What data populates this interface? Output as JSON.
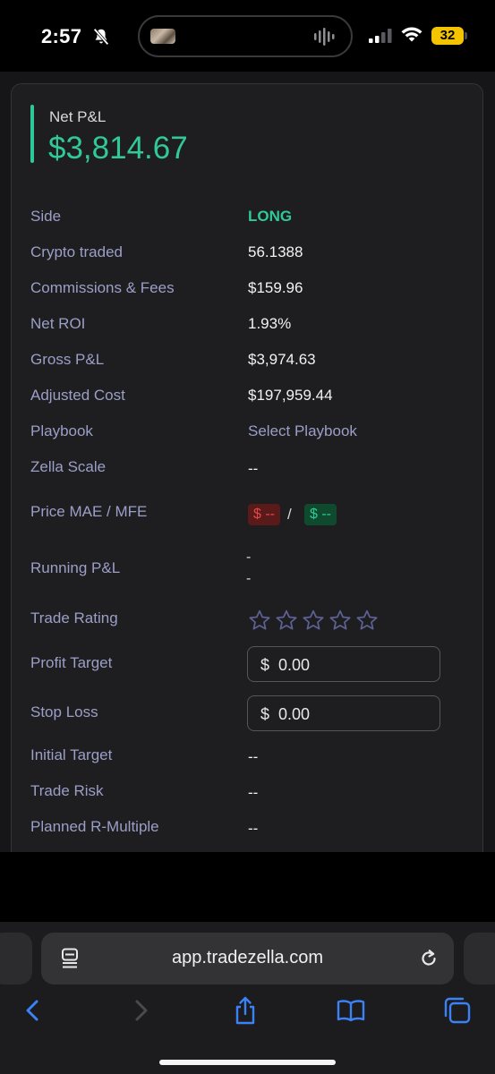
{
  "status_bar": {
    "time": "2:57",
    "battery": "32",
    "icons": [
      "bell-slash-icon",
      "audio-wave-icon",
      "signal-icon",
      "wifi-icon",
      "battery-icon"
    ]
  },
  "trade": {
    "net_pnl_label": "Net P&L",
    "net_pnl_value": "$3,814.67",
    "rows": [
      {
        "label": "Side",
        "value": "LONG"
      },
      {
        "label": "Crypto traded",
        "value": "56.1388"
      },
      {
        "label": "Commissions & Fees",
        "value": "$159.96"
      },
      {
        "label": "Net ROI",
        "value": "1.93%"
      },
      {
        "label": "Gross P&L",
        "value": "$3,974.63"
      },
      {
        "label": "Adjusted Cost",
        "value": "$197,959.44"
      },
      {
        "label": "Playbook",
        "value": "Select Playbook"
      },
      {
        "label": "Zella Scale",
        "value": "--"
      },
      {
        "label": "Price MAE / MFE",
        "mae": "$ --",
        "separator": "/",
        "mfe": "$ --"
      },
      {
        "label": "Running P&L",
        "value_line1": "-",
        "value_line2": "-"
      },
      {
        "label": "Trade Rating",
        "rating": 0,
        "max_rating": 5
      },
      {
        "label": "Profit Target",
        "currency": "$",
        "value": "0.00"
      },
      {
        "label": "Stop Loss",
        "currency": "$",
        "value": "0.00"
      },
      {
        "label": "Initial Target",
        "value": "--"
      },
      {
        "label": "Trade Risk",
        "value": "--"
      },
      {
        "label": "Planned R-Multiple",
        "value": "--"
      }
    ]
  },
  "browser": {
    "url": "app.tradezella.com"
  },
  "colors": {
    "accent_green": "#31c995",
    "label_purple": "#9b9fc7",
    "loss_red": "#e04a4a",
    "ios_blue": "#3b82f6"
  }
}
